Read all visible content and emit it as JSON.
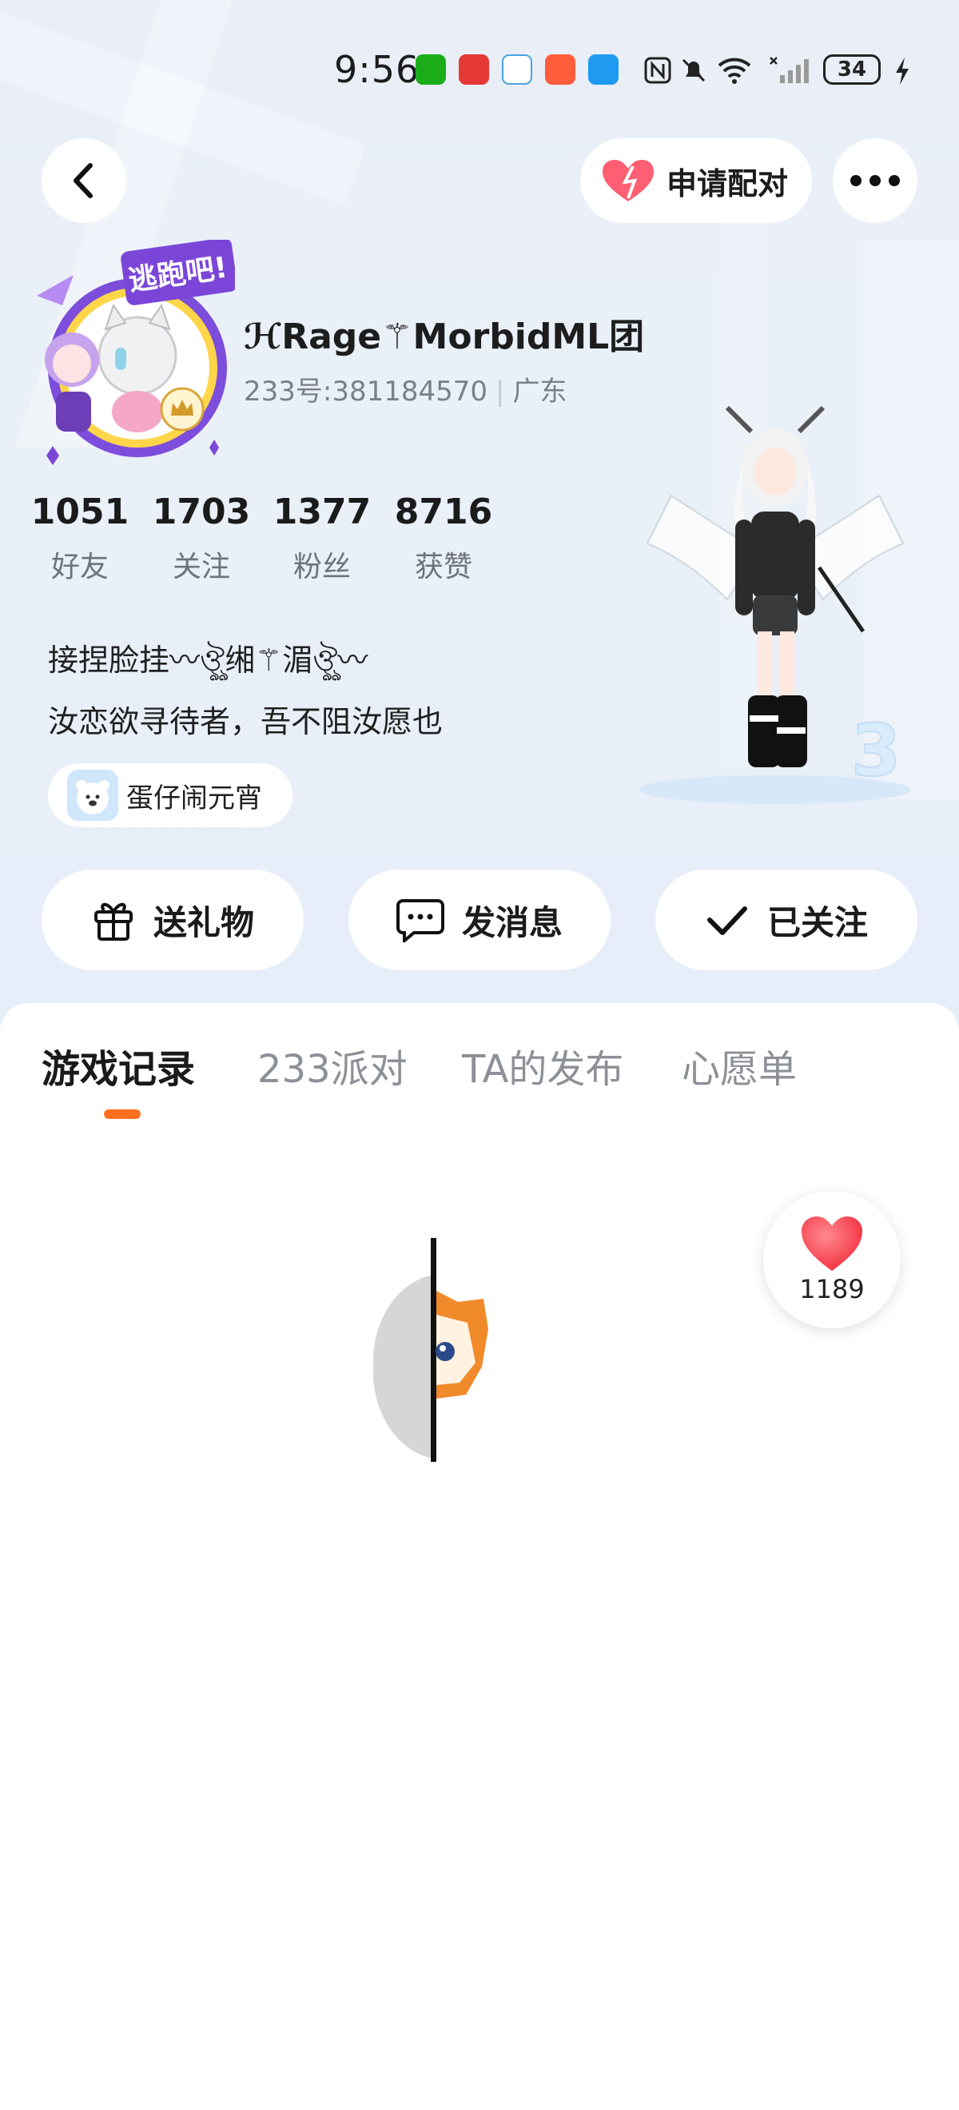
{
  "status_bar": {
    "time": "9:56",
    "battery": "34",
    "icons": [
      "wechat-icon",
      "app-red-icon",
      "browser-icon",
      "app-orange-icon",
      "search-app-icon",
      "nfc-icon",
      "mute-icon",
      "wifi-icon",
      "signal-icon",
      "battery-icon",
      "charging-icon"
    ]
  },
  "top_bar": {
    "match_label": "申请配对",
    "back_icon": "back-arrow-icon",
    "more_icon": "more-dots-icon"
  },
  "profile": {
    "avatar_badge_text": "逃跑吧!",
    "username": "ℋRage⚚MorbidML团",
    "id_text": "233号:381184570",
    "region": "广东",
    "stats": [
      {
        "value": "1051",
        "label": "好友"
      },
      {
        "value": "1703",
        "label": "关注"
      },
      {
        "value": "1377",
        "label": "粉丝"
      },
      {
        "value": "8716",
        "label": "获赞"
      }
    ],
    "bio_line1": "接捏脸挂〰ঔৣ缃⚚湄ঔৣ〰",
    "bio_line2": "汝恋欲寻待者，吾不阻汝愿也",
    "tag_label": "蛋仔闹元宵"
  },
  "actions": {
    "gift": "送礼物",
    "message": "发消息",
    "follow": "已关注"
  },
  "tabs": [
    "游戏记录",
    "233派对",
    "TA的发布",
    "心愿单"
  ],
  "like_count": "1189",
  "colors": {
    "accent": "#ff6f1f",
    "heart": "#ff4d5e",
    "header_bg": "#e9eef7"
  }
}
